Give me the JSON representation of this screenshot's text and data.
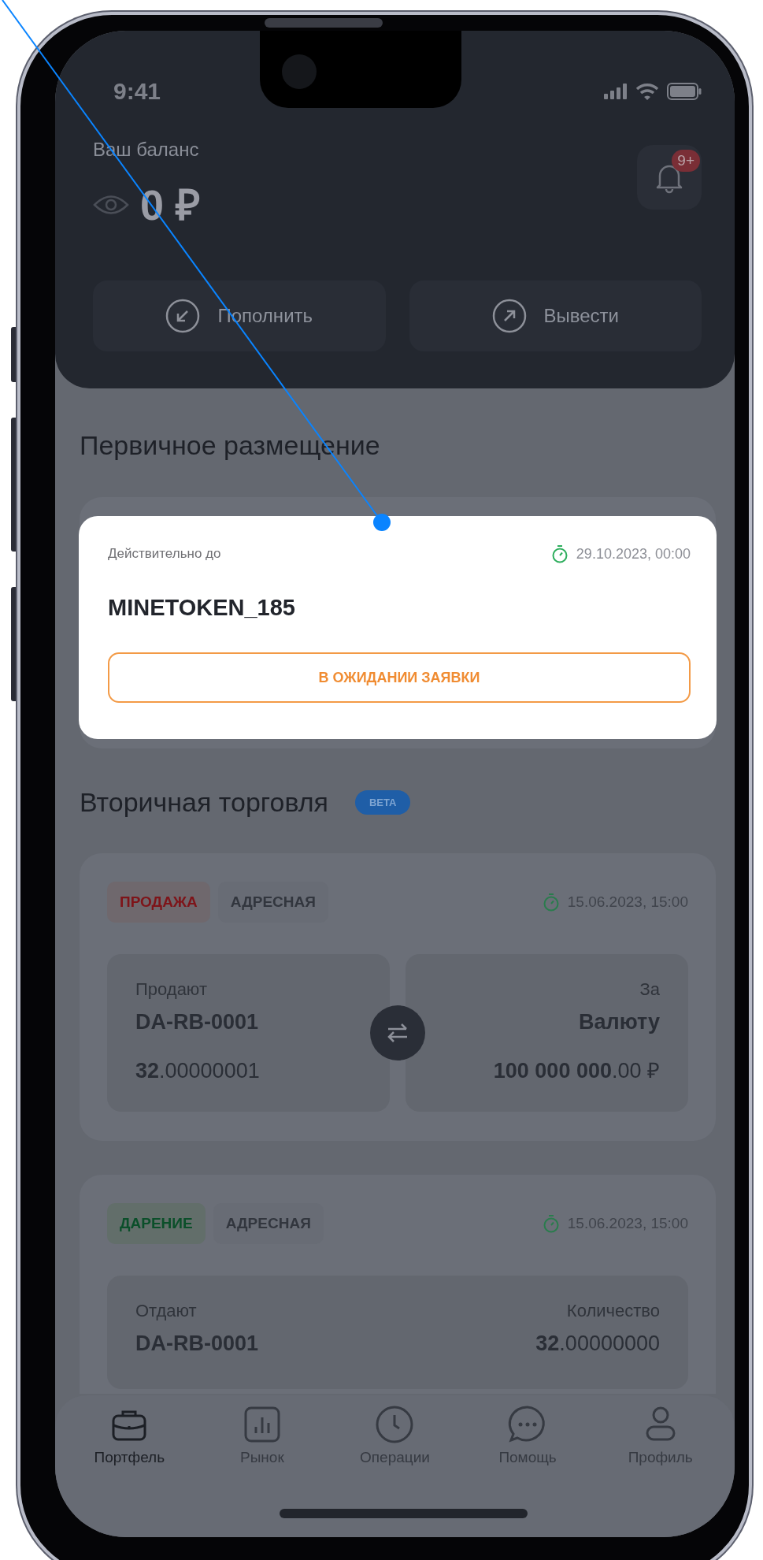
{
  "status_bar": {
    "time": "9:41"
  },
  "balance": {
    "label": "Ваш баланс",
    "amount": "0 ₽",
    "notifications_badge": "9+"
  },
  "actions": [
    {
      "label": "Пополнить",
      "kind": "in"
    },
    {
      "label": "Вывести",
      "kind": "out"
    }
  ],
  "primary": {
    "title": "Первичное размещение",
    "offer": {
      "valid_label": "Действительно до",
      "date": "29.10.2023, 00:00",
      "token": "MINETOKEN_185",
      "status": "В ОЖИДАНИИ ЗАЯВКИ"
    }
  },
  "secondary": {
    "title": "Вторичная торговля",
    "badge": "BETA",
    "deals": [
      {
        "kind": "sale",
        "tags": [
          {
            "label": "ПРОДАЖА",
            "kind": "sale"
          },
          {
            "label": "АДРЕСНАЯ",
            "kind": "address"
          }
        ],
        "date": "15.06.2023, 15:00",
        "left": {
          "label": "Продают",
          "name": "DA-RB-0001",
          "amount": "**32**.00000001"
        },
        "right": {
          "label": "За",
          "name": "Валюту",
          "amount": "**100 000 000**.00 ₽"
        }
      },
      {
        "kind": "gift",
        "tags": [
          {
            "label": "ДАРЕНИЕ",
            "kind": "gift"
          },
          {
            "label": "АДРЕСНАЯ",
            "kind": "address"
          }
        ],
        "date": "15.06.2023, 15:00",
        "left": {
          "label": "Отдают",
          "name": "DA-RB-0001"
        },
        "right": {
          "label": "Количество",
          "amount": "**32**.00000000"
        }
      }
    ]
  },
  "tabs": [
    {
      "label": "Портфель",
      "selected": true
    },
    {
      "label": "Рынок",
      "selected": false
    },
    {
      "label": "Операции",
      "selected": false
    },
    {
      "label": "Помощь",
      "selected": false
    },
    {
      "label": "Профиль",
      "selected": false
    }
  ]
}
